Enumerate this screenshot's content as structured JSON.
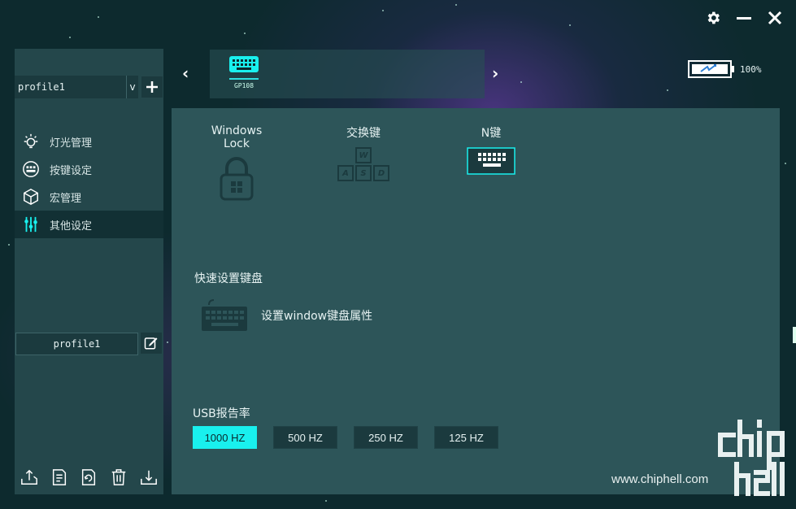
{
  "window_controls": {
    "settings_icon": "gear-icon",
    "minimize_icon": "minimize-icon",
    "close_icon": "close-icon"
  },
  "left": {
    "profile_selected": "profile1",
    "profile_arrow": "v",
    "nav": [
      {
        "label": "灯光管理",
        "icon": "bulb-icon"
      },
      {
        "label": "按键设定",
        "icon": "keys-icon"
      },
      {
        "label": "宏管理",
        "icon": "cube-icon"
      },
      {
        "label": "其他设定",
        "icon": "sliders-icon",
        "active": true
      }
    ],
    "profile_name": "profile1"
  },
  "device": {
    "name": "GP108"
  },
  "battery": {
    "percent_label": "100%",
    "level": 1.0
  },
  "main": {
    "features": [
      {
        "title": "Windows Lock",
        "icon": "lock-icon"
      },
      {
        "title": "交换键",
        "icon": "wasd-icon"
      },
      {
        "title": "N键",
        "icon": "keyboard-icon"
      }
    ],
    "wasd_keys": [
      "W",
      "A",
      "S",
      "D"
    ],
    "quick_title": "快速设置键盘",
    "quick_text": "设置window键盘属性",
    "usb_title": "USB报告率",
    "rates": [
      "1000 HZ",
      "500 HZ",
      "250 HZ",
      "125 HZ"
    ],
    "active_rate": 0
  },
  "watermark": {
    "url": "www.chiphell.com"
  },
  "colors": {
    "accent": "#19f0ee",
    "panel": "#2d5559",
    "sidebar": "#24474b",
    "dark": "#1b3a3e"
  }
}
